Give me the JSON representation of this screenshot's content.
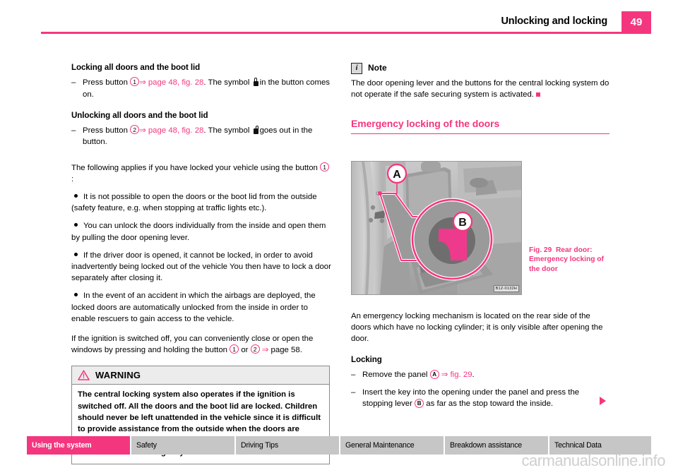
{
  "header": {
    "title": "Unlocking and locking",
    "page_number": "49",
    "accent_color": "#f4367f"
  },
  "left_column": {
    "heading_1": "Locking all doors and the boot lid",
    "item_1": {
      "dash": "–",
      "text_before": "Press button",
      "circle": "1",
      "arrow": "⇒",
      "link": "page 48, fig. 28",
      "text_mid": ". The symbol",
      "symbol": "lock-closed-icon",
      "text_after": "in the button comes on."
    },
    "heading_2": "Unlocking all doors and the boot lid",
    "item_2": {
      "dash": "–",
      "text_before": "Press button",
      "circle": "2",
      "arrow": "⇒",
      "link": "page 48, fig. 28",
      "text_mid": ". The symbol",
      "symbol": "lock-open-icon",
      "text_after": "goes out in the button."
    },
    "intro": {
      "text_before": "The following applies if you have locked your vehicle using the button",
      "circle": "1",
      "text_after": ":"
    },
    "bullets": [
      "It is not possible to open the doors or the boot lid from the outside (safety feature, e.g. when stopping at traffic lights etc.).",
      "You can unlock the doors individually from the inside and open them by pulling the door opening lever.",
      "If the driver door is opened, it cannot be locked, in order to avoid inadvertently being locked out of the vehicle You then have to lock a door separately after closing it.",
      "In the event of an accident in which the airbags are deployed, the locked doors are automatically unlocked from the inside in order to enable rescuers to gain access to the vehicle."
    ],
    "closing": {
      "text_before": "If the ignition is switched off, you can conveniently close or open the windows by pressing and holding the button",
      "circle_1": "1",
      "or": "or",
      "circle_2": "2",
      "arrow": "⇒",
      "text_after": "page 58."
    },
    "warning": {
      "icon": "warning-triangle-icon",
      "title": "WARNING",
      "body": "The central locking system also operates if the ignition is switched off. All the doors and the boot lid are locked. Children should never be left unattended in the vehicle since it is difficult to provide assistance from the outside when the doors are locked. Locked doors make it difficult for rescuers to get into the vehicle in an emergency - hazard!"
    }
  },
  "right_column": {
    "note": {
      "icon": "info-icon",
      "icon_glyph": "i",
      "title": "Note",
      "body": "The door opening lever and the buttons for the central locking system do not operate if the safe securing system is activated.",
      "end_mark": "■"
    },
    "section_heading": "Emergency locking of the doors",
    "figure": {
      "label_a": "A",
      "label_b": "B",
      "image_code": "B1Z-0132H",
      "caption_number": "Fig. 29",
      "caption_text": "Rear door: Emergency locking of the door"
    },
    "paragraph": "An emergency locking mechanism is located on the rear side of the doors which have no locking cylinder; it is only visible after opening the door.",
    "heading_locking": "Locking",
    "step_1": {
      "dash": "–",
      "text_before": "Remove the panel",
      "circle": "A",
      "arrow": "⇒",
      "link": "fig. 29",
      "text_after": "."
    },
    "step_2": {
      "dash": "–",
      "text_before": "Insert the key into the opening under the panel and press the stopping lever",
      "circle": "B",
      "text_after": "as far as the stop toward the inside."
    },
    "continue_arrow": "▶"
  },
  "footer": {
    "tabs": [
      {
        "label": "Using the system",
        "active": true
      },
      {
        "label": "Safety",
        "active": false
      },
      {
        "label": "Driving Tips",
        "active": false
      },
      {
        "label": "General Maintenance",
        "active": false
      },
      {
        "label": "Breakdown assistance",
        "active": false
      },
      {
        "label": "Technical Data",
        "active": false
      }
    ],
    "watermark": "carmanualsonline.info"
  }
}
